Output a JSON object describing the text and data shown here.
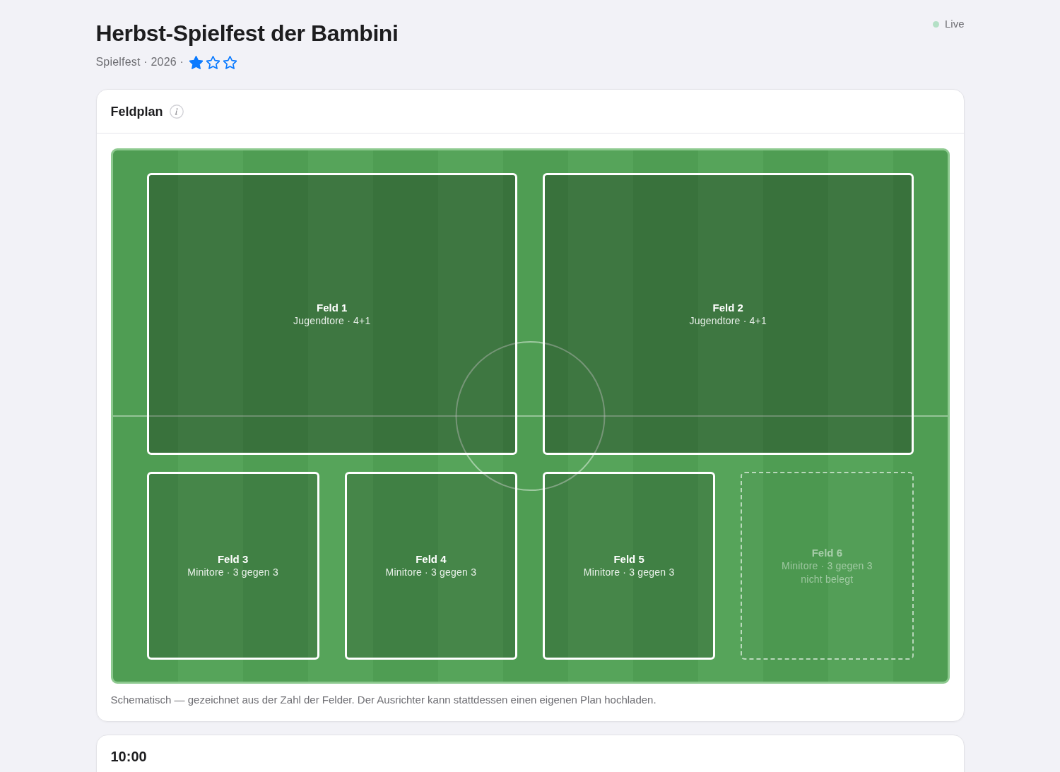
{
  "header": {
    "title": "Herbst-Spielfest der Bambini",
    "meta": "Spielfest · 2026 ·",
    "stars": 1,
    "status": {
      "label": "Live",
      "color": "#b4e0c6"
    }
  },
  "field_plan": {
    "title": "Feldplan",
    "fields": [
      {
        "kind": "large",
        "name": "Feld 1",
        "detail": "Jugendtore · 4+1",
        "occupied": true
      },
      {
        "kind": "large",
        "name": "Feld 2",
        "detail": "Jugendtore · 4+1",
        "occupied": true
      },
      {
        "kind": "small",
        "name": "Feld 3",
        "detail": "Minitore · 3 gegen 3",
        "occupied": true
      },
      {
        "kind": "small",
        "name": "Feld 4",
        "detail": "Minitore · 3 gegen 3",
        "occupied": true
      },
      {
        "kind": "small",
        "name": "Feld 5",
        "detail": "Minitore · 3 gegen 3",
        "occupied": true
      },
      {
        "kind": "small",
        "name": "Feld 6",
        "detail": "Minitore · 3 gegen 3",
        "note": "nicht belegt",
        "occupied": false
      }
    ],
    "caption": "Schematisch — gezeichnet aus der Zahl der Felder. Der Ausrichter kann stattdessen einen eigenen Plan hochladen."
  },
  "time_slots": [
    {
      "time": "10:00"
    }
  ]
}
